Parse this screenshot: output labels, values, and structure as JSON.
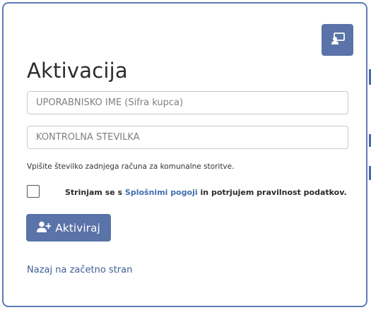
{
  "modal": {
    "title": "Aktivacija",
    "corner_icon": "user-desk-icon"
  },
  "form": {
    "username_placeholder": "UPORABNIŠKO IME (Šifra kupca)",
    "username_value": "",
    "code_placeholder": "KONTROLNA ŠTEVILKA",
    "code_value": "",
    "hint": "Vpišite številko zadnjega računa za komunalne storitve.",
    "consent_prefix": "Strinjam se s",
    "consent_link": "Splošnimi pogoji",
    "consent_suffix": "in potrjujem pravilnost podatkov.",
    "consent_checked": false
  },
  "actions": {
    "activate_label": "Aktiviraj",
    "activate_icon": "user-plus-icon",
    "back_label": "Nazaj na začetno stran"
  },
  "colors": {
    "primary": "#5a73a8",
    "modal_border": "#5b7cb8",
    "link": "#3f6fb0"
  }
}
